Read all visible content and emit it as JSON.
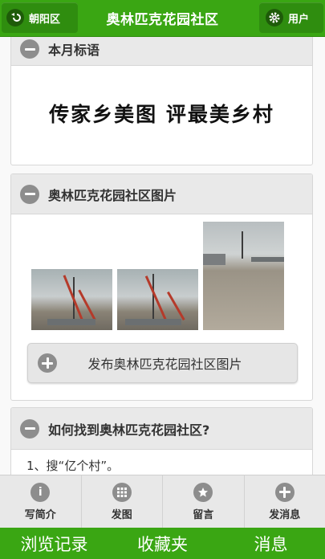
{
  "header": {
    "title": "奥林匹克花园社区",
    "back_label": "朝阳区",
    "user_label": "用户"
  },
  "sections": {
    "slogan": {
      "heading": "本月标语",
      "text": "传家乡美图 评最美乡村"
    },
    "photos": {
      "heading": "奥林匹克花园社区图片",
      "publish_label": "发布奥林匹克花园社区图片"
    },
    "find": {
      "heading": "如何找到奥林匹克花园社区?",
      "step1": "1、搜“亿个村”。"
    }
  },
  "toolbar": {
    "items": [
      {
        "label": "写简介",
        "icon": "info-icon"
      },
      {
        "label": "发图",
        "icon": "grid-icon"
      },
      {
        "label": "留言",
        "icon": "star-icon"
      },
      {
        "label": "发消息",
        "icon": "plus-icon"
      }
    ]
  },
  "bottom_nav": {
    "items": [
      {
        "label": "浏览记录"
      },
      {
        "label": "收藏夹"
      },
      {
        "label": "消息"
      }
    ]
  },
  "colors": {
    "brand_green": "#3aa613",
    "dark_green": "#2f8d0f",
    "icon_gray": "#8d8d8d"
  }
}
